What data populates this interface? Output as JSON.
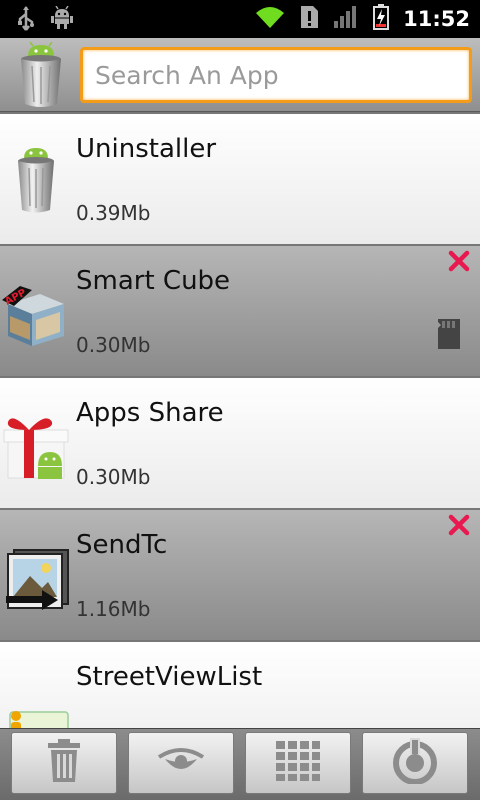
{
  "status_bar": {
    "time": "11:52",
    "icons": [
      "usb-icon",
      "android-debug-icon",
      "wifi-icon",
      "alert-icon",
      "signal-icon",
      "battery-charging-icon"
    ]
  },
  "header": {
    "icon": "trash-can-android-icon",
    "search": {
      "placeholder": "Search An App",
      "value": ""
    },
    "accent_color": "#f39c1a"
  },
  "apps": [
    {
      "name": "Uninstaller",
      "size": "0.39Mb",
      "icon": "trash-can-android-icon",
      "style": "light",
      "removable": false,
      "on_sd": false
    },
    {
      "name": "Smart Cube",
      "size": "0.30Mb",
      "icon": "cube-app-icon",
      "style": "dark",
      "removable": true,
      "on_sd": true
    },
    {
      "name": "Apps Share",
      "size": "0.30Mb",
      "icon": "gift-android-icon",
      "style": "light",
      "removable": false,
      "on_sd": false
    },
    {
      "name": "SendTc",
      "size": "1.16Mb",
      "icon": "picture-send-icon",
      "style": "dark",
      "removable": true,
      "on_sd": false
    },
    {
      "name": "StreetViewList",
      "size": "",
      "icon": "street-view-list-icon",
      "style": "light",
      "removable": false,
      "on_sd": false
    }
  ],
  "bottom_bar": {
    "buttons": [
      "trash-icon",
      "eye-icon",
      "grid-icon",
      "power-icon"
    ]
  },
  "colors": {
    "remove_x": "#e8194f"
  }
}
